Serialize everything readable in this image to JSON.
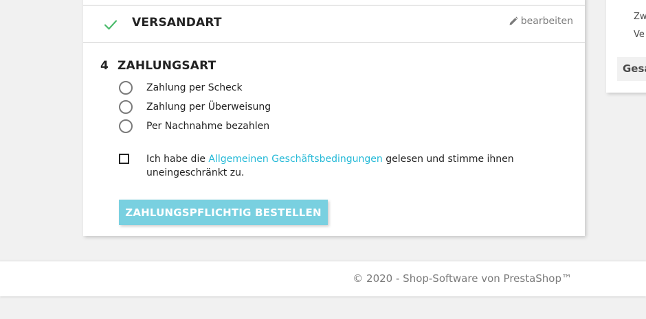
{
  "checkout": {
    "completed_step": {
      "title": "VERSANDART",
      "edit_label": "bearbeiten"
    },
    "current_step": {
      "number": "4",
      "title": "ZAHLUNGSART",
      "payment_options": [
        {
          "label": "Zahlung per Scheck"
        },
        {
          "label": "Zahlung per Überweisung"
        },
        {
          "label": "Per Nachnahme bezahlen"
        }
      ],
      "terms": {
        "prefix": "Ich habe die ",
        "link": "Allgemeinen Geschäftsbedingungen",
        "suffix": " gelesen und stimme ihnen uneingeschränkt zu."
      },
      "order_button": "ZAHLUNGSPFLICHTIG BESTELLEN"
    }
  },
  "summary": {
    "line1": "Zw",
    "line2": "Ve",
    "total": "Gesa"
  },
  "footer": {
    "text": "© 2020 - Shop-Software von PrestaShop™"
  },
  "colors": {
    "accent": "#24b9d7",
    "button_disabled": "#79d0e0",
    "check": "#4cbb6c",
    "text": "#232323",
    "muted": "#7a7a7a",
    "background": "#f1f1f1"
  },
  "icons": {
    "completed": "check-icon",
    "edit": "pencil-icon"
  }
}
